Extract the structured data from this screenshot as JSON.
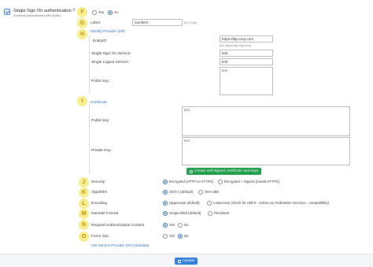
{
  "header": {
    "title": "Single Sign On authentication ?",
    "subtitle": "(External authentication with SAML)"
  },
  "badges": [
    "F",
    "G",
    "H",
    "I",
    "J",
    "K",
    "L",
    "M",
    "N",
    "O"
  ],
  "enable": {
    "yes": "Yes",
    "no": "No",
    "selected": "No"
  },
  "label_field": {
    "label": "Label:",
    "value": "samltest",
    "hint": "(Ex: Corp)"
  },
  "identity_provider": {
    "link": "Identify Provider (IdP)",
    "entity_id_label": "EntityID:",
    "entity_id_value": "https://idp.corp.com",
    "entity_id_hint": "(Ex: https://idp.corp.com)",
    "sso_label": "Single Sign On Service:",
    "sso_value": "test",
    "slo_label": "Single Logout Service:",
    "slo_value": "test",
    "public_key_label": "Public key:",
    "public_key_value": "test"
  },
  "certificate": {
    "link": "Certificate",
    "public_key_label": "Public key:",
    "public_key_value": "test",
    "private_key_label": "Private Key:",
    "private_key_value": "test",
    "create_button": "Create self-signed certificate and keys"
  },
  "security": {
    "label": "Security",
    "options": [
      "Encrypted (HTTP or HTTPS)",
      "Encrypted + Signed (needs HTTPS)"
    ],
    "selected": "Encrypted (HTTP or HTTPS)"
  },
  "algorithm": {
    "label": "Algorithm",
    "options": [
      "SHA-1 (default)",
      "SHA-256"
    ],
    "selected": "SHA-1 (default)"
  },
  "encoding": {
    "label": "Encoding",
    "options": [
      "Uppercase (default)",
      "Lowercase (check for ADFS - Active.ory Federation Services - compatibility)"
    ],
    "selected": "Uppercase (default)"
  },
  "nameid_format": {
    "label": "NameID Format",
    "options": [
      "Unspecified (default)",
      "Persistent"
    ],
    "selected": "Unspecified (default)"
  },
  "request_auth_context": {
    "label": "Request Authentication Context",
    "options": [
      "Yes",
      "No"
    ],
    "selected": "Yes"
  },
  "force_ssl": {
    "label": "Force SSL",
    "options": [
      "Yes",
      "No"
    ],
    "selected": "No"
  },
  "sp_metadata_link": "Get Service Provider (SP) Metadata",
  "update_button": "Update",
  "colors": {
    "badge_bg": "#f6ef8f",
    "badge_text": "#c98b00",
    "link": "#2f6fb8",
    "green": "#1f9d4a",
    "blue": "#2f7bd8"
  }
}
